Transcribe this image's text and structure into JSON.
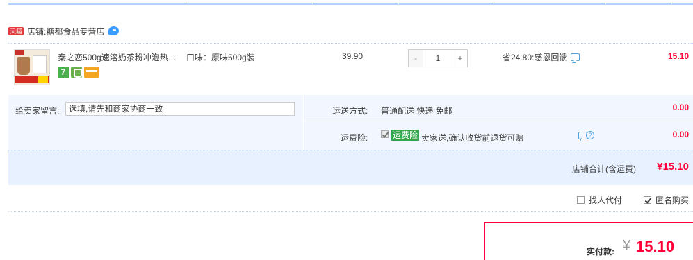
{
  "shop": {
    "badge": "天猫",
    "label": "店铺:",
    "name": "糖都食品专营店"
  },
  "item": {
    "title": "秦之恋500g速溶奶茶粉冲泡热…",
    "service_icon_label": "7",
    "sku": "口味：原味500g装",
    "price": "39.90",
    "qty_minus": "-",
    "quantity": "1",
    "qty_plus": "+",
    "discount": "省24.80:感恩回馈",
    "total": "15.10"
  },
  "options": {
    "message_label": "给卖家留言:",
    "message_placeholder": "选填,请先和商家协商一致",
    "shipping_label": "运送方式:",
    "shipping_value": "普通配送 快递 免邮",
    "shipping_fee": "0.00",
    "insurance_label": "运费险:",
    "insurance_tag": "运费险",
    "insurance_desc": "卖家送,确认收货前退货可赔",
    "insurance_help": "?",
    "insurance_fee": "0.00"
  },
  "subtotal": {
    "label": "店铺合计(含运费)",
    "value": "¥15.10"
  },
  "extras": {
    "proxy_pay": "找人代付",
    "proxy_checked": false,
    "anonymous": "匿名购买",
    "anonymous_checked": true
  },
  "payment": {
    "label": "实付款:",
    "currency": "¥",
    "value": "15.10"
  },
  "colors": {
    "price_red": "#ff0036",
    "accent_blue": "#b2d1ff",
    "panel_bg": "#f2f7ff",
    "insurance_green": "#31a64c"
  }
}
